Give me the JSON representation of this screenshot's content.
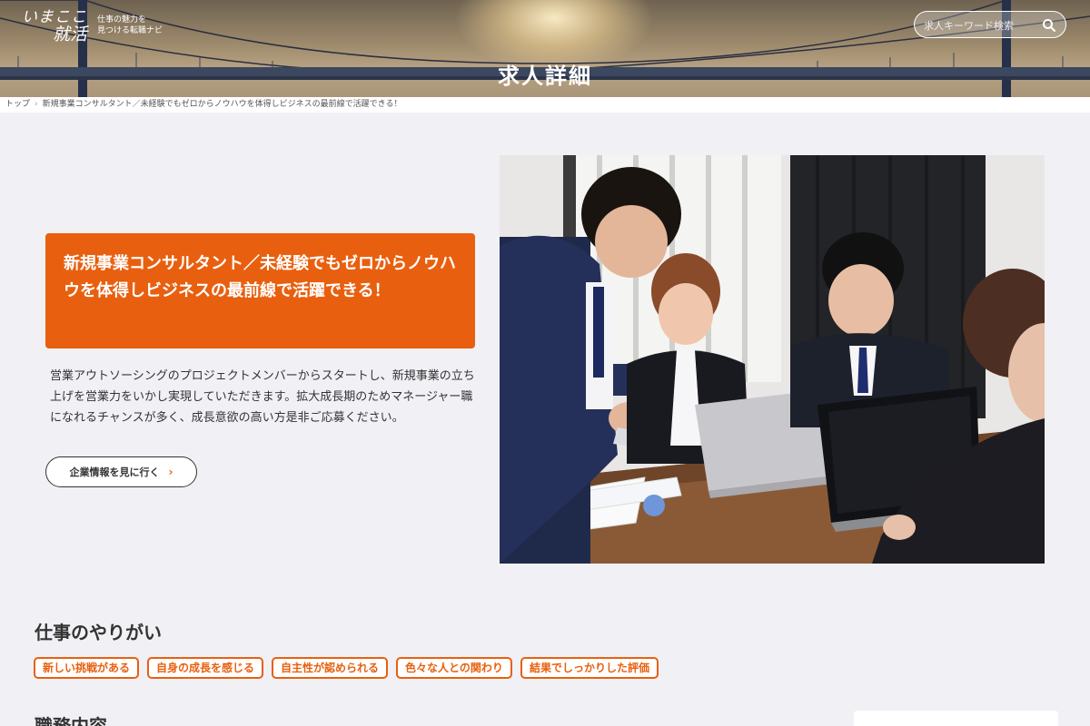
{
  "header": {
    "logo_line1": "いまここ",
    "logo_line2": "就活",
    "tagline_line1": "仕事の魅力を",
    "tagline_line2": "見つける転職ナビ",
    "page_title": "求人詳細",
    "search_placeholder": "求人キーワード検索"
  },
  "breadcrumb": {
    "home": "トップ",
    "current": "新規事業コンサルタント／未経験でもゼロからノウハウを体得しビジネスの最前線で活躍できる！"
  },
  "job": {
    "title": "新規事業コンサルタント／未経験でもゼロからノウハウを体得しビジネスの最前線で活躍できる！",
    "description": "営業アウトソーシングのプロジェクトメンバーからスタートし、新規事業の立ち上げを営業力をいかし実現していただきます。拡大成長期のためマネージャー職になれるチャンスが多く、成長意欲の高い方是非ご応募ください。",
    "company_button": "企業情報を見に行く",
    "company_button_chevron": "›"
  },
  "sections": {
    "yarigai_title": "仕事のやりがい",
    "yarigai_tags": [
      "新しい挑戦がある",
      "自身の成長を感じる",
      "自主性が認められる",
      "色々な人との関わり",
      "結果でしっかりした評価"
    ],
    "duties_title": "職務内容"
  },
  "colors": {
    "accent": "#e8600f",
    "background": "#f1f0f5"
  }
}
